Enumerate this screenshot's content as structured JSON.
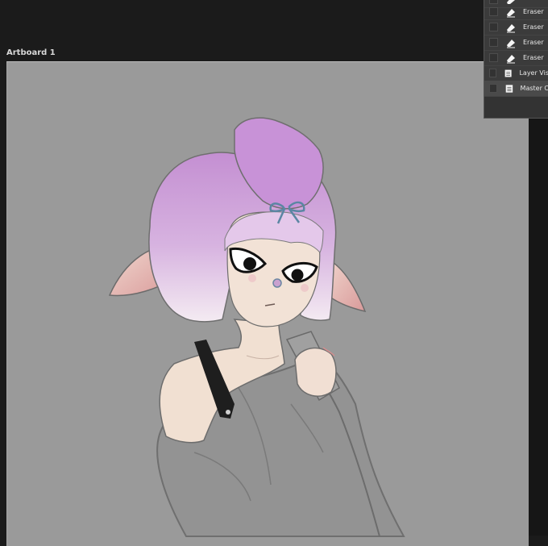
{
  "artboard": {
    "title": "Artboard 1"
  },
  "history": {
    "items": [
      {
        "label": "",
        "icon": "eraser-icon"
      },
      {
        "label": "Eraser",
        "icon": "eraser-icon"
      },
      {
        "label": "Eraser",
        "icon": "eraser-icon"
      },
      {
        "label": "Eraser",
        "icon": "eraser-icon"
      },
      {
        "label": "Eraser",
        "icon": "eraser-icon"
      },
      {
        "label": "Layer Vis",
        "icon": "document-icon"
      },
      {
        "label": "Master C",
        "icon": "document-icon"
      }
    ]
  },
  "colors": {
    "app_background": "#1b1b1b",
    "canvas": "#9a9a9a",
    "hair": "#c79bd6",
    "skin": "#f2e0d3",
    "sweater": "#8f8f8f"
  }
}
